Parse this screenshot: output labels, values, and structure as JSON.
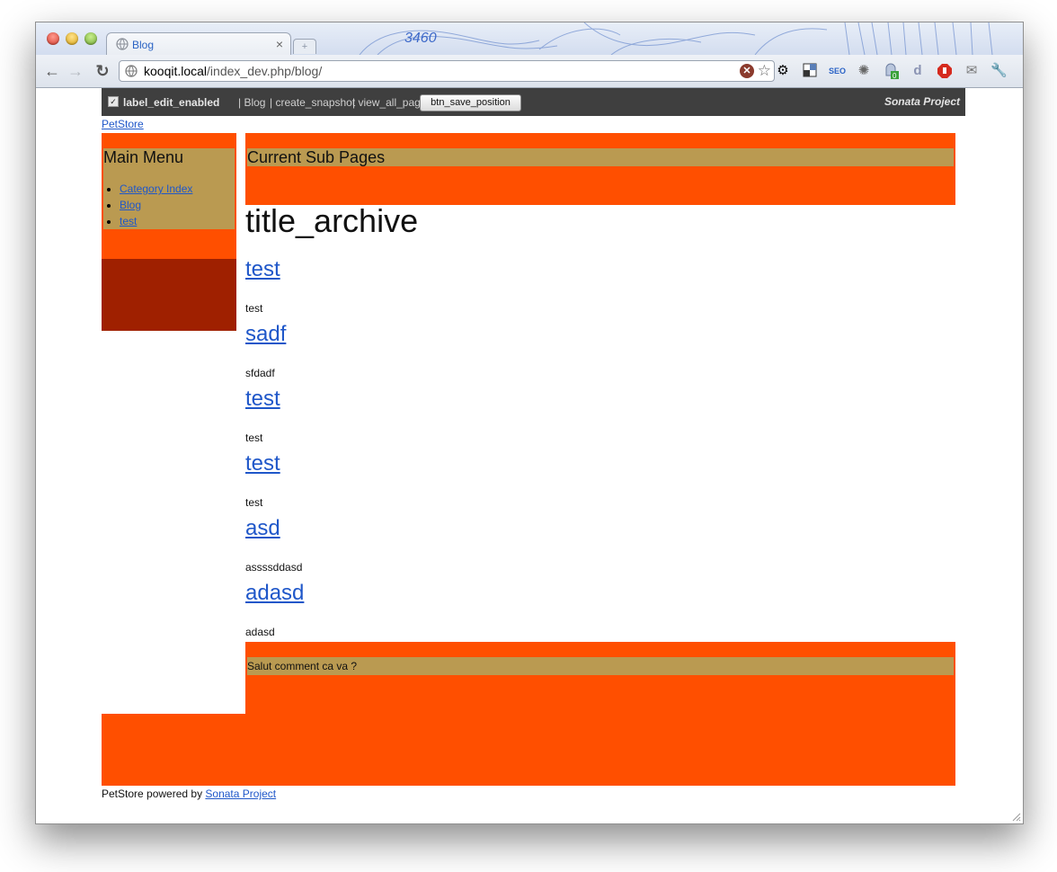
{
  "browser": {
    "tab_title": "Blog",
    "tab_close": "×",
    "url_host": "kooqit.local",
    "url_path": "/index_dev.php/blog/",
    "extensions": [
      "stop-icon",
      "star-icon",
      "gear-icon",
      "pixel-icon",
      "seo-icon",
      "sun-icon",
      "ghostery-icon",
      "d-icon",
      "adblock-icon",
      "notes-icon",
      "wrench-icon"
    ],
    "ghostery_badge": "0",
    "seo_label": "SEO",
    "d_label": "d"
  },
  "adminbar": {
    "label_edit": "label_edit_enabled",
    "links": [
      " | Blog",
      " | create_snapshot",
      " | view_all_pages"
    ],
    "button": "btn_save_position",
    "brand": "Sonata Project"
  },
  "breadcrumb": "PetStore",
  "menu": {
    "title": "Main Menu",
    "items": [
      "Category Index",
      "Blog",
      "test"
    ]
  },
  "subpages_title": "Current Sub Pages",
  "page_title": "title_archive",
  "posts": [
    {
      "title": "test",
      "body": "test"
    },
    {
      "title": "sadf",
      "body": "sfdadf"
    },
    {
      "title": "test",
      "body": "test"
    },
    {
      "title": "test",
      "body": "test"
    },
    {
      "title": "asd",
      "body": "assssddasd"
    },
    {
      "title": "adasd",
      "body": "adasd"
    }
  ],
  "salut": "Salut comment ca va ?",
  "footer": {
    "text": "PetStore powered by ",
    "link": "Sonata Project"
  },
  "colors": {
    "orange": "#ff4f00",
    "khaki": "#ba9a51",
    "dark_red": "#9f2000",
    "admin_bar": "#3f3f3f",
    "link": "#1f57c9"
  }
}
